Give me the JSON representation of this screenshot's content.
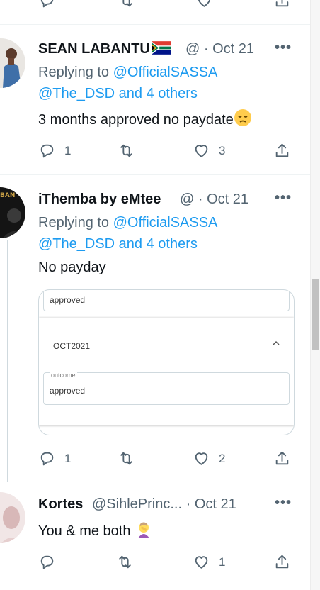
{
  "top_actions": {
    "reply": "",
    "retweet": "",
    "like": "",
    "share": ""
  },
  "tweets": [
    {
      "name": "SEAN LABANTU",
      "handle": "@",
      "dot": "·",
      "date": "Oct 21",
      "replying_prefix": "Replying to",
      "replying_to_1": "@OfficialSASSA",
      "replying_to_2": "@The_DSD and 4 others",
      "text": "3 months approved no paydate",
      "reply_count": "1",
      "retweet_count": "",
      "like_count": "3"
    },
    {
      "name": "iThemba by eMtee",
      "handle": "@",
      "dot": "·",
      "date": "Oct 21",
      "replying_prefix": "Replying to",
      "replying_to_1": "@OfficialSASSA",
      "replying_to_2": "@The_DSD and 4 others",
      "text": "No payday",
      "reply_count": "1",
      "retweet_count": "",
      "like_count": "2",
      "media": {
        "top_value": "approved",
        "month": "OCT2021",
        "outcome_label": "outcome",
        "outcome_value": "approved"
      }
    },
    {
      "name": "Kortes",
      "handle": "@SihlePrinc...",
      "dot": "·",
      "date": "Oct 21",
      "text": "You & me both",
      "reply_count": "",
      "retweet_count": "",
      "like_count": "1"
    }
  ],
  "more_label": "•••",
  "colors": {
    "accent": "#1d9bf0",
    "secondary_text": "#536471",
    "divider": "#eff3f4"
  },
  "icons": [
    "reply-icon",
    "retweet-icon",
    "like-icon",
    "share-icon",
    "more-icon",
    "south-africa-flag-icon",
    "disappointed-face-emoji",
    "face-palm-emoji"
  ]
}
